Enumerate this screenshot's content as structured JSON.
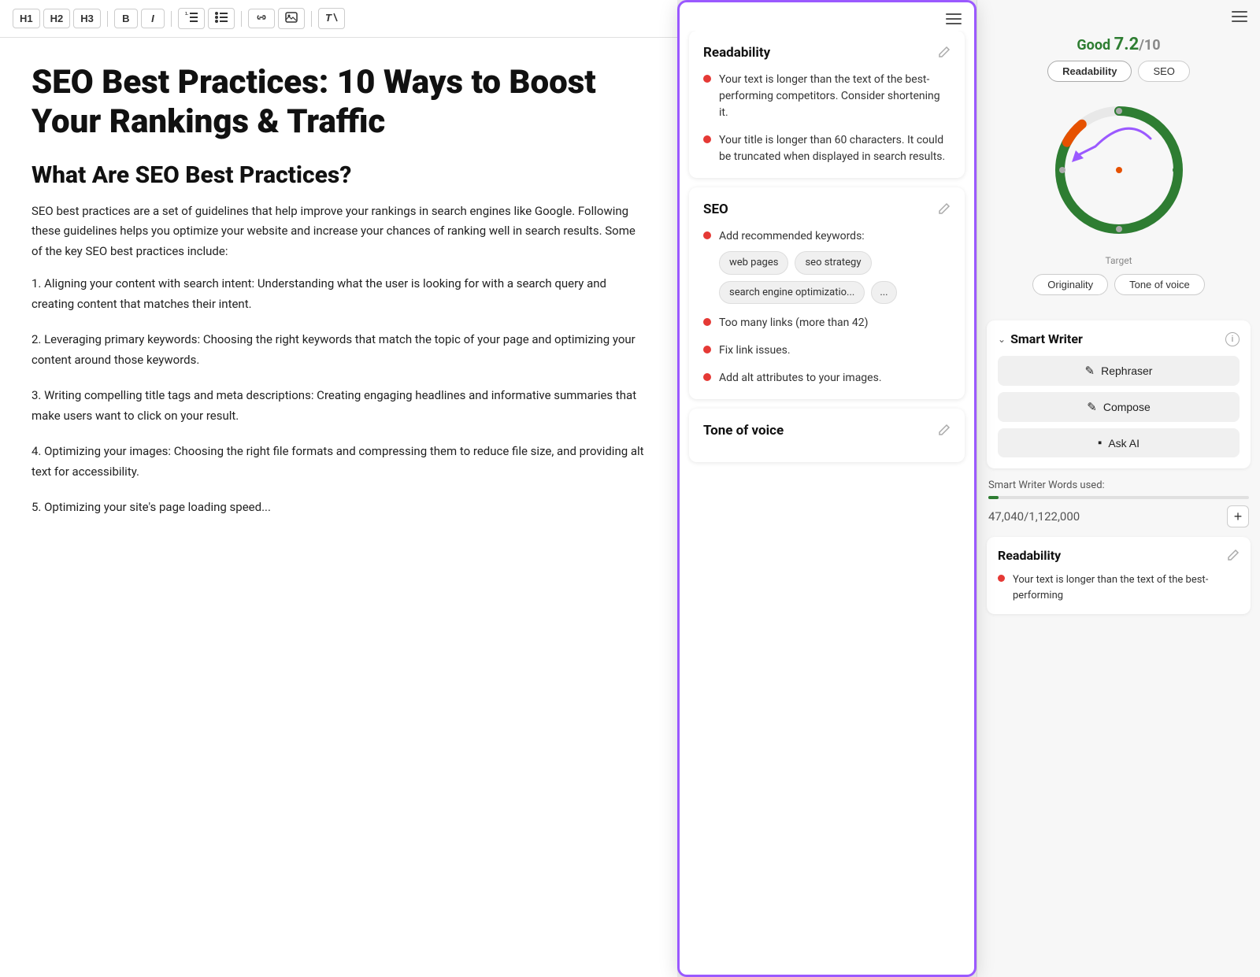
{
  "toolbar": {
    "buttons": [
      "H1",
      "H2",
      "H3",
      "B",
      "I",
      "ol",
      "ul",
      "link",
      "image",
      "clear"
    ]
  },
  "editor": {
    "title": "SEO Best Practices: 10 Ways to Boost Your Rankings & Traffic",
    "heading2": "What Are SEO Best Practices?",
    "paragraphs": [
      "SEO best practices are a set of guidelines that help improve your rankings in search engines like Google. Following these guidelines helps you optimize your website and increase your chances of ranking well in search results. Some of the key SEO best practices include:",
      "1. Aligning your content with search intent: Understanding what the user is looking for with a search query and creating content that matches their intent.",
      "2. Leveraging primary keywords: Choosing the right keywords that match the topic of your page and optimizing your content around those keywords.",
      "3. Writing compelling title tags and meta descriptions: Creating engaging headlines and informative summaries that make users want to click on your result.",
      "4. Optimizing your images: Choosing the right file formats and compressing them to reduce file size, and providing alt text for accessibility.",
      "5. Optimizing your site's page loading speed..."
    ]
  },
  "center_panel": {
    "menu_icon": "≡",
    "sections": [
      {
        "id": "readability",
        "title": "Readability",
        "bullets": [
          "Your text is longer than the text of the best-performing competitors. Consider shortening it.",
          "Your title is longer than 60 characters. It could be truncated when displayed in search results."
        ]
      },
      {
        "id": "seo",
        "title": "SEO",
        "bullets_prefix": [
          "Add recommended keywords:"
        ],
        "keywords": [
          "web pages",
          "seo strategy",
          "search engine optimizatio...",
          "..."
        ],
        "bullets_suffix": [
          "Too many links (more than 42)",
          "Fix link issues.",
          "Add alt attributes to your images."
        ]
      },
      {
        "id": "tone_of_voice",
        "title": "Tone of voice"
      }
    ]
  },
  "right_panel": {
    "score": {
      "label": "Good",
      "value": "7.2",
      "total": "/10"
    },
    "tabs_top": [
      "Readability",
      "SEO"
    ],
    "donut": {
      "target_label": "Target"
    },
    "tabs_bottom": [
      "Originality",
      "Tone of voice"
    ],
    "smart_writer": {
      "title": "Smart Writer",
      "buttons": [
        "Rephraser",
        "Compose",
        "Ask AI"
      ],
      "words_label": "Smart Writer Words used:",
      "words_count": "47,040",
      "words_total": "/1,122,000"
    },
    "readability": {
      "title": "Readability",
      "bullet": "Your text is longer than the text of the best-performing"
    }
  }
}
